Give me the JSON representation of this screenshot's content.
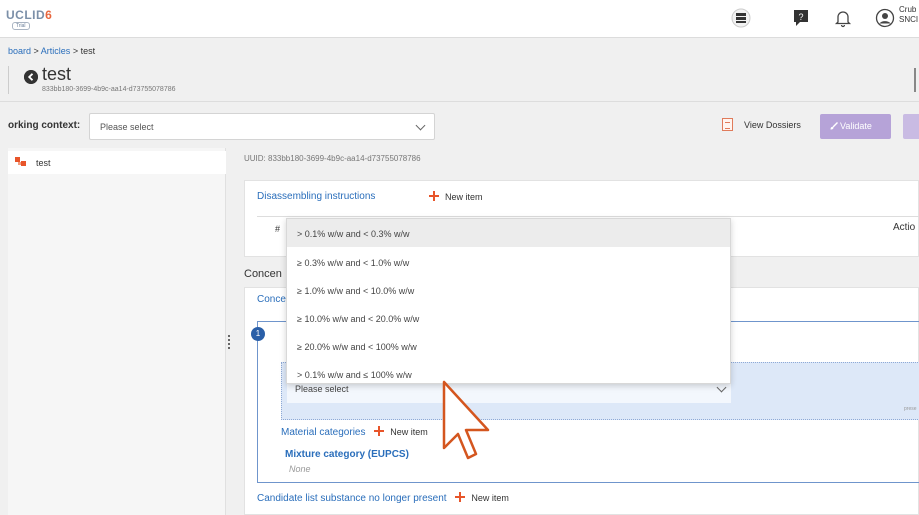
{
  "topbar": {
    "logo_text": "UCLID",
    "logo_number": "6",
    "logo_badge": "Trial",
    "user_name_line1": "Crub",
    "user_name_line2": "SNCI"
  },
  "header": {
    "breadcrumb_home": "board",
    "breadcrumb_sep1": " > ",
    "breadcrumb_articles": "Articles",
    "breadcrumb_sep2": " > ",
    "breadcrumb_current": "test",
    "title": "test",
    "uuid_short": "833bb180-3699-4b9c-aa14-d73755078786"
  },
  "context_bar": {
    "label": "orking context:",
    "select_placeholder": "Please select",
    "view_dossiers": "View Dossiers",
    "validate": "Validate"
  },
  "left_panel": {
    "tree_item": "test"
  },
  "main": {
    "uuid_line": "UUID: 833bb180-3699-4b9c-aa14-d73755078786",
    "disassembling_title": "Disassembling instructions",
    "new_item": "New item",
    "table_hash": "#",
    "table_action": "Actio",
    "concentration_head": "Concen",
    "concentration_sub": "Conce",
    "badge_number": "1",
    "inner_select_placeholder": "Please select",
    "tiny_right_text": "prese",
    "material_categories": "Material categories",
    "mixture_category": "Mixture category (EUPCS)",
    "mixture_none": "None",
    "candidate_list": "Candidate list substance no longer present"
  },
  "dropdown": {
    "options": [
      "> 0.1% w/w and < 0.3% w/w",
      "≥ 0.3% w/w and < 1.0% w/w",
      "≥ 1.0% w/w and < 10.0% w/w",
      "≥ 10.0% w/w and < 20.0% w/w",
      "≥ 20.0% w/w and < 100% w/w",
      "> 0.1% w/w and ≤ 100% w/w"
    ]
  },
  "colors": {
    "link_blue": "#2a6ebb",
    "accent_orange": "#e8552a",
    "validate_purple": "#b6a3d8"
  },
  "icons": [
    "logo-icon",
    "server-icon",
    "help-icon",
    "bell-icon",
    "user-icon",
    "back-icon",
    "dossier-icon",
    "brush-icon",
    "tree-article-icon",
    "plus-icon",
    "chevron-down-icon",
    "mouse-cursor-icon"
  ]
}
